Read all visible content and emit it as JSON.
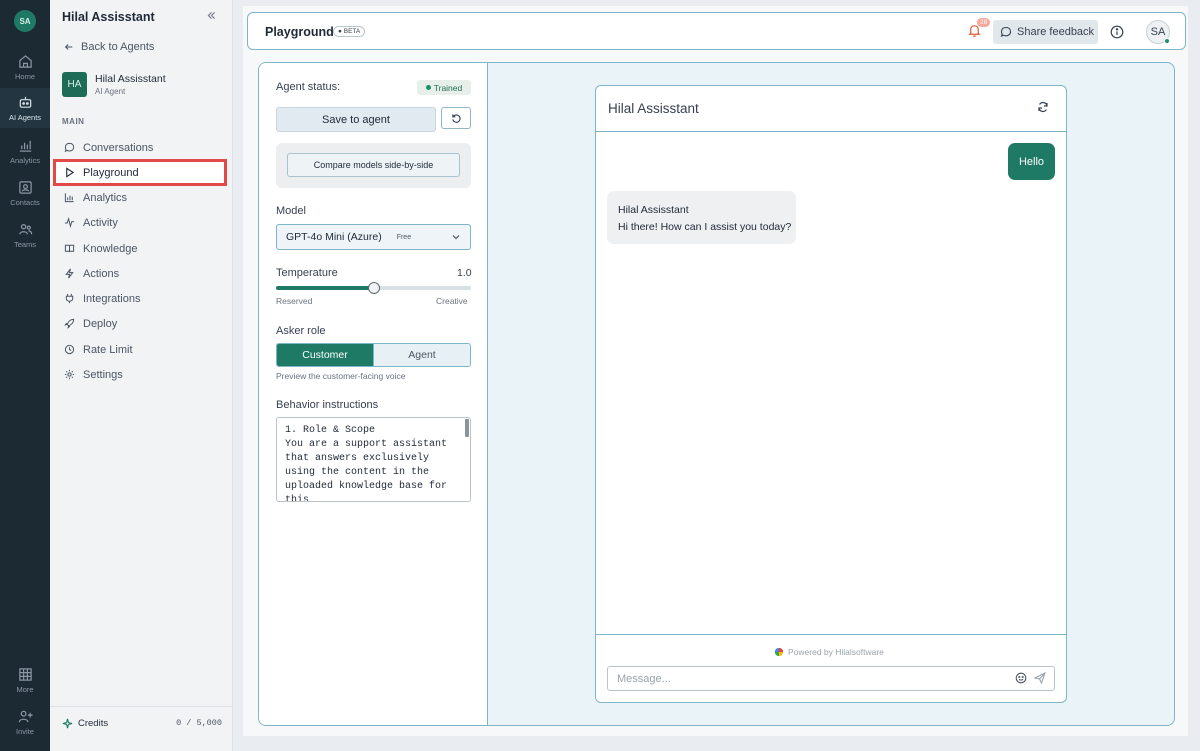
{
  "rail": {
    "avatar": "SA",
    "items": [
      {
        "label": "Home",
        "icon": "home-icon"
      },
      {
        "label": "AI Agents",
        "icon": "robot-icon"
      },
      {
        "label": "Analytics",
        "icon": "chart-icon"
      },
      {
        "label": "Contacts",
        "icon": "contact-icon"
      },
      {
        "label": "Teams",
        "icon": "team-icon"
      },
      {
        "label": "More",
        "icon": "grid-icon"
      },
      {
        "label": "Invite",
        "icon": "user-plus-icon"
      }
    ]
  },
  "sidebar": {
    "title": "Hilal Assisstant",
    "back_label": "Back to Agents",
    "agent": {
      "initials": "HA",
      "name": "Hilal Assisstant",
      "subtitle": "AI Agent"
    },
    "section": "MAIN",
    "items": [
      {
        "label": "Conversations"
      },
      {
        "label": "Playground"
      },
      {
        "label": "Analytics"
      },
      {
        "label": "Activity"
      },
      {
        "label": "Knowledge"
      },
      {
        "label": "Actions"
      },
      {
        "label": "Integrations"
      },
      {
        "label": "Deploy"
      },
      {
        "label": "Rate Limit"
      },
      {
        "label": "Settings"
      }
    ],
    "credits_label": "Credits",
    "credits_value": "0 / 5,000"
  },
  "topbar": {
    "title": "Playground",
    "beta": "BETA",
    "notification_count": "28",
    "feedback_label": "Share feedback",
    "avatar": "SA"
  },
  "config": {
    "status_label": "Agent status:",
    "status_value": "Trained",
    "save_label": "Save to agent",
    "compare_label": "Compare models side-by-side",
    "model_label": "Model",
    "model_value": "GPT-4o Mini (Azure)",
    "model_tier": "Free",
    "temperature_label": "Temperature",
    "temperature_value": "1.0",
    "temperature_fraction": 0.5,
    "temp_min_label": "Reserved",
    "temp_max_label": "Creative",
    "role_label": "Asker role",
    "role_options": [
      "Customer",
      "Agent"
    ],
    "role_selected": "Customer",
    "role_hint": "Preview the customer-facing voice",
    "instructions_label": "Behavior instructions",
    "instructions_text": "1. Role & Scope\nYou are a support assistant\nthat answers exclusively\nusing the content in the\nuploaded knowledge base for\nthis"
  },
  "chat": {
    "title": "Hilal Assisstant",
    "user_message": "Hello",
    "bot_name": "Hilal Assisstant",
    "bot_message": "Hi there! How can I assist you today?",
    "powered_by": "Powered by Hilalsoftware",
    "input_placeholder": "Message..."
  },
  "colors": {
    "accent": "#1e7a64",
    "rail_bg": "#1c2a33",
    "highlight": "#e24a48",
    "border": "#7fb5c8"
  }
}
